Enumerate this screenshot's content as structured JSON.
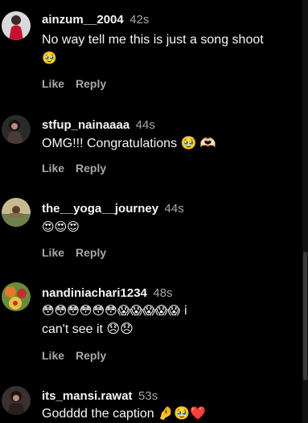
{
  "colors": {
    "background": "#000000",
    "text": "#f5f5f5",
    "muted": "#a8a8a8"
  },
  "comments": [
    {
      "username": "ainzum__2004",
      "time": "42s",
      "text_line1": "No way tell me this is just a song shoot",
      "text_line2": "🥹",
      "like": "Like",
      "reply": "Reply"
    },
    {
      "username": "stfup_nainaaaa",
      "time": "44s",
      "text_line1": "OMG!!! Congratulations 🥹 🫶🏻",
      "like": "Like",
      "reply": "Reply"
    },
    {
      "username": "the__yoga__journey",
      "time": "44s",
      "text_line1": "😍😍😍",
      "like": "Like",
      "reply": "Reply"
    },
    {
      "username": "nandiniachari1234",
      "time": "48s",
      "text_line1": "😳😳😳😳😳😳😱😱😱😱😱 i",
      "text_line2": "can't see it 😞😞",
      "like": "Like",
      "reply": "Reply"
    },
    {
      "username": "its_mansi.rawat",
      "time": "53s",
      "text_line1": "Godddd the caption 🤌🥹❤️"
    }
  ]
}
